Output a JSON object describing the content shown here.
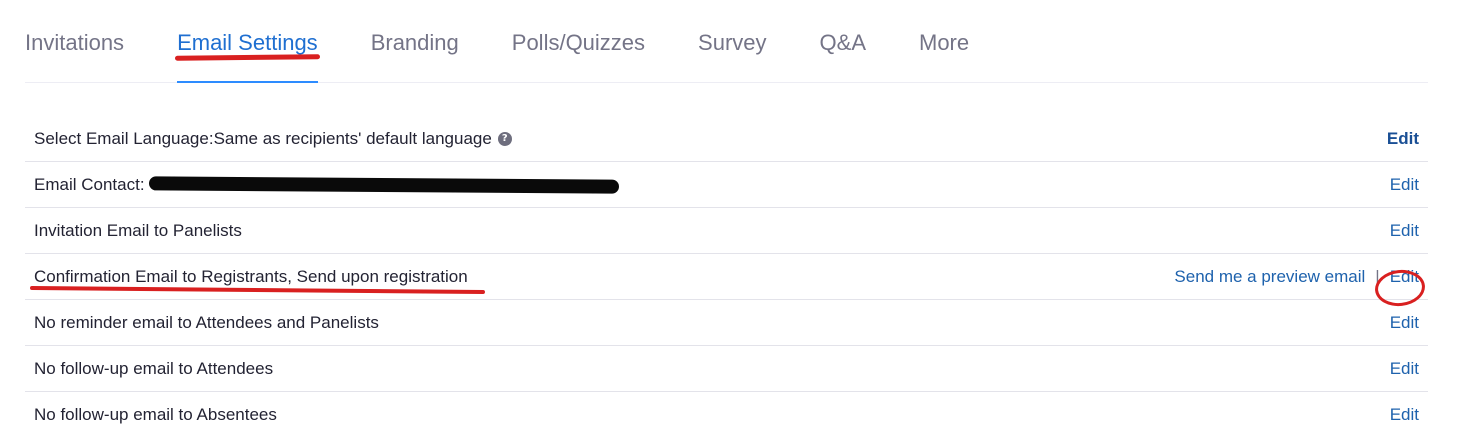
{
  "tabs": [
    {
      "label": "Invitations",
      "active": false
    },
    {
      "label": "Email Settings",
      "active": true
    },
    {
      "label": "Branding",
      "active": false
    },
    {
      "label": "Polls/Quizzes",
      "active": false
    },
    {
      "label": "Survey",
      "active": false
    },
    {
      "label": "Q&A",
      "active": false
    },
    {
      "label": "More",
      "active": false
    }
  ],
  "settings": {
    "rows": [
      {
        "label": "Select Email Language:Same as recipients' default language",
        "edit": "Edit"
      },
      {
        "label": "Email Contact:",
        "edit": "Edit"
      },
      {
        "label": "Invitation Email to Panelists",
        "edit": "Edit"
      },
      {
        "label": "Confirmation Email to Registrants, Send upon registration",
        "preview": "Send me a preview email",
        "separator": "|",
        "edit": "Edit"
      },
      {
        "label": "No reminder email to Attendees and Panelists",
        "edit": "Edit"
      },
      {
        "label": "No follow-up email to Attendees",
        "edit": "Edit"
      },
      {
        "label": "No follow-up email to Absentees",
        "edit": "Edit"
      }
    ],
    "help_icon_glyph": "?"
  },
  "colors": {
    "accent": "#2d8cff",
    "link": "#1e62ad",
    "annotation_red": "#d92020",
    "text": "#232333",
    "muted": "#747487"
  }
}
